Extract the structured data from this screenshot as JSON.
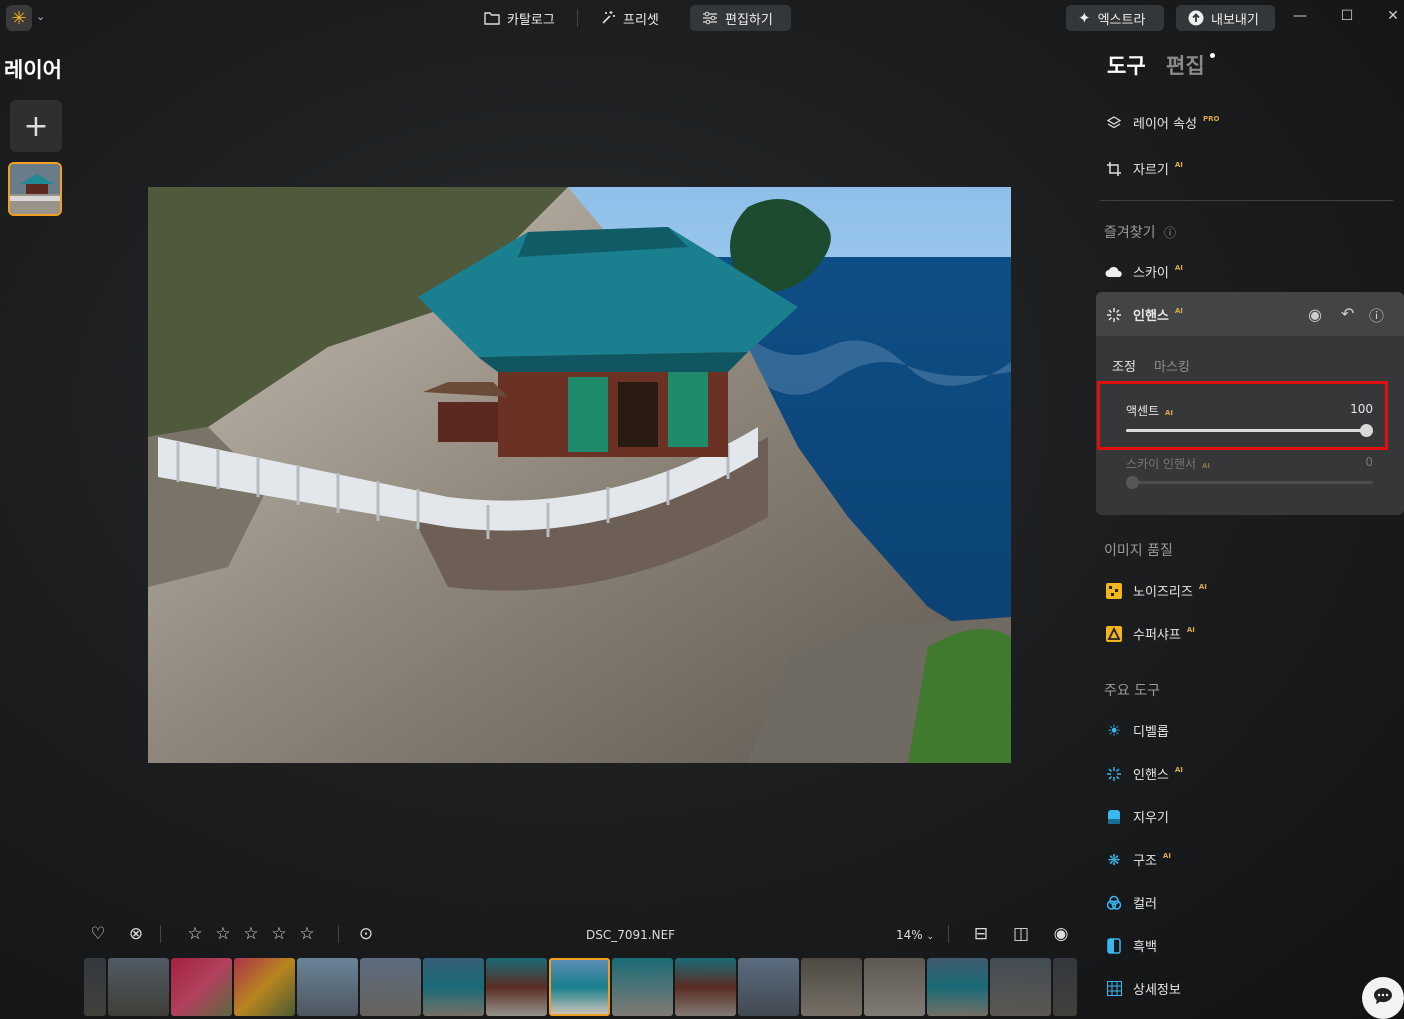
{
  "topbar": {
    "catalog": "카탈로그",
    "presets": "프리셋",
    "edit": "편집하기",
    "extra": "엑스트라",
    "export": "내보내기"
  },
  "left_panel": {
    "title": "레이어"
  },
  "bottom": {
    "filename": "DSC_7091.NEF",
    "zoom": "14%"
  },
  "right_panel": {
    "tab_tools": "도구",
    "tab_edits": "편집",
    "layer_props": "레이어 속성",
    "layer_props_badge": "PRO",
    "crop": "자르기",
    "favorites_title": "즐겨찾기",
    "sky": "스카이",
    "enhance": {
      "title": "인핸스",
      "subtab_adjust": "조정",
      "subtab_masking": "마스킹",
      "accent_label": "액센트",
      "accent_value": "100",
      "accent_level": 100,
      "sky_enhancer_label": "스카이 인핸서",
      "sky_enhancer_value": "0",
      "sky_enhancer_level": 0
    },
    "image_quality_title": "이미지 품질",
    "noiseless": "노이즈리즈",
    "supersharp": "수퍼샤프",
    "essentials_title": "주요 도구",
    "develop": "디벨롭",
    "enhance2": "인핸스",
    "erase": "지우기",
    "structure": "구조",
    "color": "컬러",
    "bw": "흑백",
    "details": "상세정보",
    "ai_badge": "AI"
  },
  "colors": {
    "accent_orange": "#f0a020",
    "highlight_red": "#e01010"
  }
}
